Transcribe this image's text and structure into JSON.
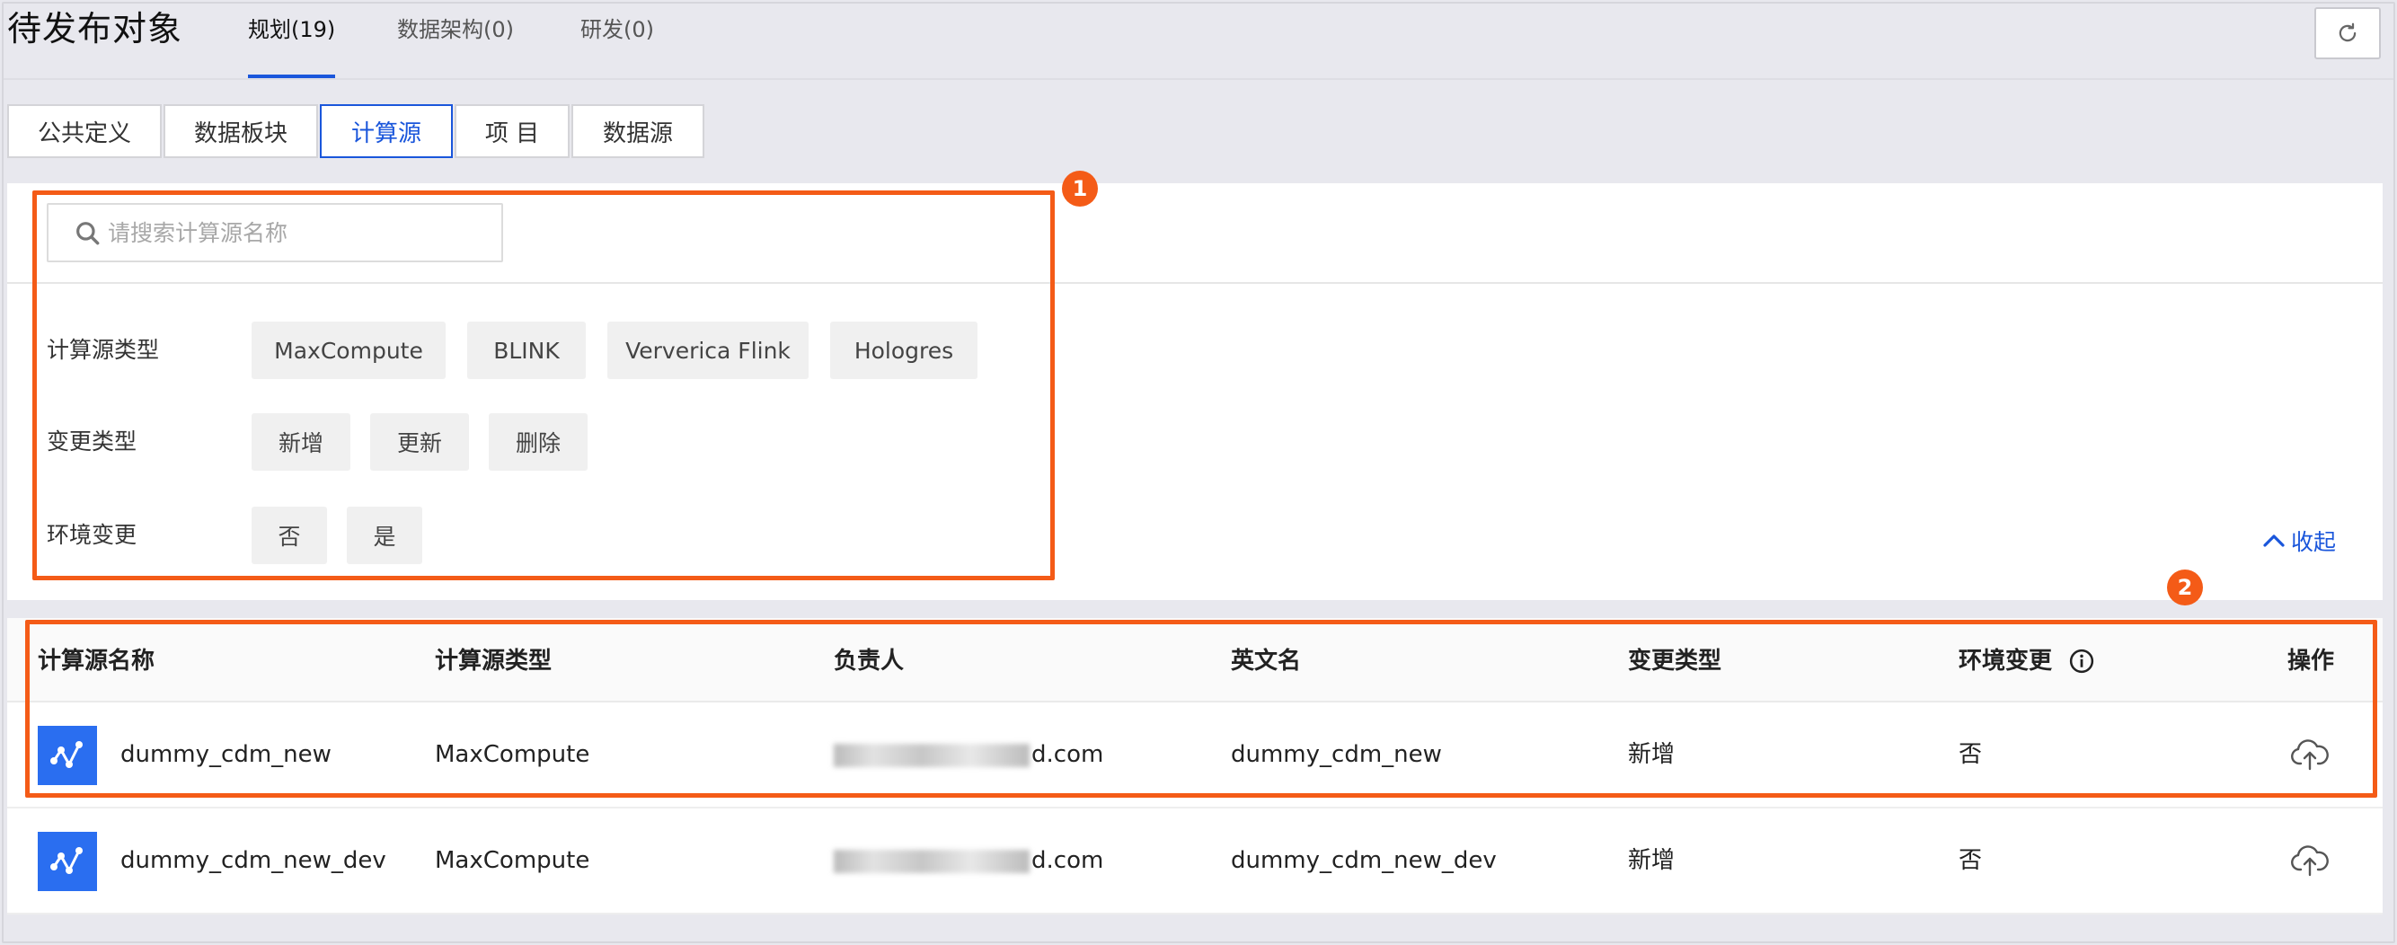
{
  "header": {
    "title": "待发布对象",
    "tabs": [
      {
        "label": "规划(19)",
        "active": true
      },
      {
        "label": "数据架构(0)",
        "active": false
      },
      {
        "label": "研发(0)",
        "active": false
      }
    ],
    "refresh_icon": "refresh-icon"
  },
  "sub_tabs": [
    {
      "label": "公共定义",
      "active": false
    },
    {
      "label": "数据板块",
      "active": false
    },
    {
      "label": "计算源",
      "active": true
    },
    {
      "label": "项 目",
      "active": false
    },
    {
      "label": "数据源",
      "active": false
    }
  ],
  "filters": {
    "search": {
      "placeholder": "请搜索计算源名称",
      "value": ""
    },
    "compute_type": {
      "label": "计算源类型",
      "options": [
        "MaxCompute",
        "BLINK",
        "Ververica Flink",
        "Hologres"
      ]
    },
    "change_type": {
      "label": "变更类型",
      "options": [
        "新增",
        "更新",
        "删除"
      ]
    },
    "env_change": {
      "label": "环境变更",
      "options": [
        "否",
        "是"
      ]
    },
    "collapse_label": "收起"
  },
  "table": {
    "columns": [
      "计算源名称",
      "计算源类型",
      "负责人",
      "英文名",
      "变更类型",
      "环境变更",
      "操作"
    ],
    "rows": [
      {
        "name": "dummy_cdm_new",
        "type": "MaxCompute",
        "owner_suffix": "d.com",
        "english_name": "dummy_cdm_new",
        "change_type": "新增",
        "env_change": "否"
      },
      {
        "name": "dummy_cdm_new_dev",
        "type": "MaxCompute",
        "owner_suffix": "d.com",
        "english_name": "dummy_cdm_new_dev",
        "change_type": "新增",
        "env_change": "否"
      }
    ]
  },
  "annotations": {
    "badge1": "1",
    "badge2": "2"
  },
  "colors": {
    "accent": "#1a56db",
    "annotation": "#f45b17",
    "row_icon": "#2a6ef0"
  }
}
